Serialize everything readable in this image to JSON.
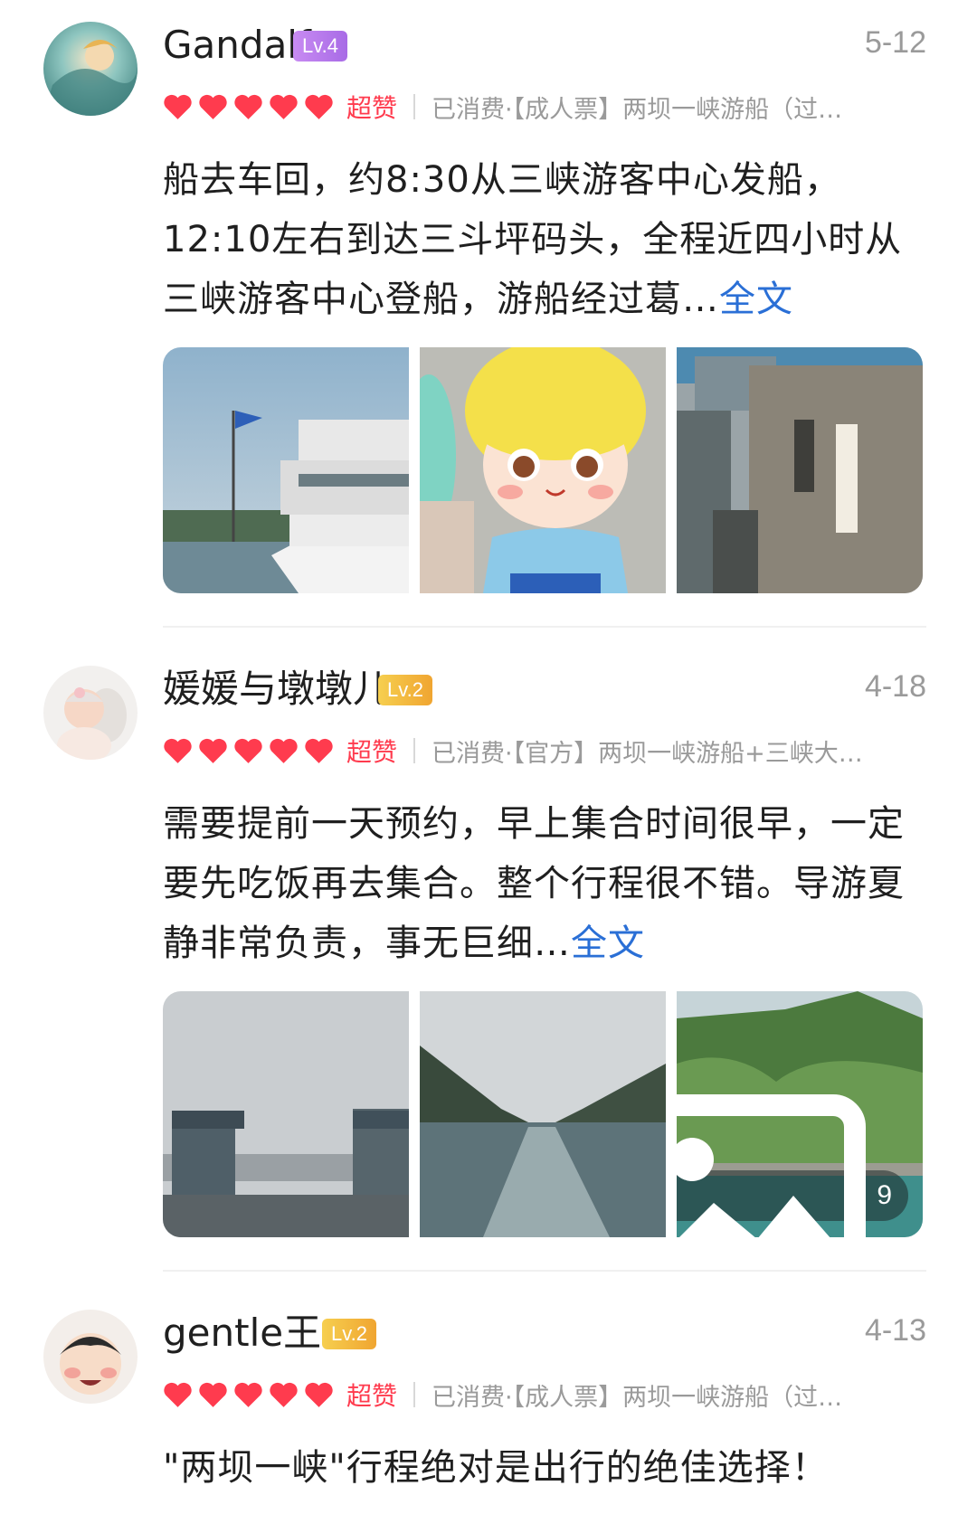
{
  "reviews": [
    {
      "username": "Gandalf",
      "level": "Lv.4",
      "date": "5-12",
      "rating_label": "超赞",
      "consumed": "已消费·【成人票】两坝一峡游船（过…",
      "text": "船去车回，约8:30从三峡游客中心发船，12:10左右到达三斗坪码头，全程近四小时从三峡游客中心登船，游船经过葛…",
      "more_label": "全文"
    },
    {
      "username": "媛媛与墩墩儿",
      "level": "Lv.2",
      "date": "4-18",
      "rating_label": "超赞",
      "consumed": "已消费·【官方】两坝一峡游船+三峡大…",
      "text": "需要提前一天预约，早上集合时间很早，一定要先吃饭再去集合。整个行程很不错。导游夏静非常负责，事无巨细…",
      "more_label": "全文",
      "photo_count": "9"
    },
    {
      "username": "gentle王",
      "level": "Lv.2",
      "date": "4-13",
      "rating_label": "超赞",
      "consumed": "已消费·【成人票】两坝一峡游船（过…",
      "text": "\"两坝一峡\"行程绝对是出行的绝佳选择！"
    }
  ],
  "colors": {
    "heart": "#ff3b4e",
    "link": "#2a6fd6",
    "muted": "#9a9a9a",
    "lv4": "#b87aee",
    "lv2": "#f2b83c"
  },
  "icons": [
    "heart-icon",
    "gallery-icon"
  ]
}
